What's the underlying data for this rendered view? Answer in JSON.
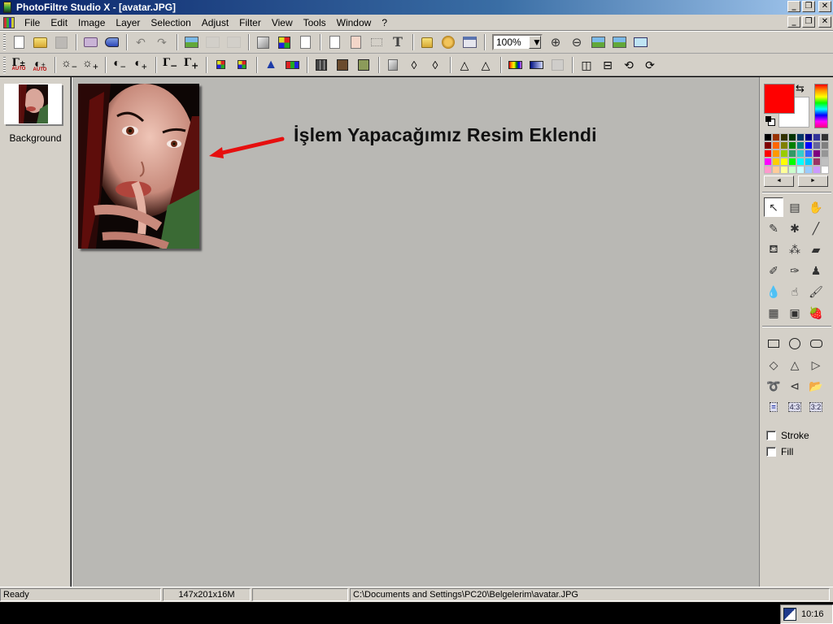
{
  "window": {
    "title": "PhotoFiltre Studio X - [avatar.JPG]",
    "controls": {
      "minimize": "_",
      "restore": "❐",
      "close": "✕"
    }
  },
  "menu": {
    "items": [
      "File",
      "Edit",
      "Image",
      "Layer",
      "Selection",
      "Adjust",
      "Filter",
      "View",
      "Tools",
      "Window",
      "?"
    ]
  },
  "toolbar1": {
    "buttons": [
      {
        "name": "new-icon"
      },
      {
        "name": "open-icon"
      },
      {
        "name": "save-icon",
        "disabled": true
      },
      {
        "name": "print-icon"
      },
      {
        "name": "scan-icon"
      },
      {
        "name": "undo-icon",
        "disabled": true
      },
      {
        "name": "redo-icon",
        "disabled": true
      },
      {
        "name": "image-browser-icon"
      },
      {
        "name": "paste-as-image-icon",
        "disabled": true
      },
      {
        "name": "duplicate-icon",
        "disabled": true
      },
      {
        "name": "grayscale-icon"
      },
      {
        "name": "color-count-icon"
      },
      {
        "name": "transparency-icon"
      },
      {
        "name": "image-size-icon"
      },
      {
        "name": "canvas-size-icon"
      },
      {
        "name": "selection-icon"
      },
      {
        "name": "text-icon"
      },
      {
        "name": "explorer-icon"
      },
      {
        "name": "plugin-icon"
      },
      {
        "name": "window-icon"
      }
    ],
    "zoom": {
      "value": "100%"
    },
    "zoom_buttons": [
      "zoom-in-icon",
      "zoom-out-icon",
      "fit-image-icon",
      "actual-size-icon",
      "slideshow-icon"
    ],
    "glyphs": {
      "undo": "↶",
      "redo": "↷",
      "text": "T",
      "zoom_in": "⊕",
      "zoom_out": "⊖",
      "dropdown": "▼"
    }
  },
  "toolbar2": {
    "auto_label": "AUTO",
    "glyphs": {
      "gamma": "Γ",
      "plusminus": "±",
      "contrast": "◐",
      "sun": "☼",
      "minus": "−",
      "plus": "+",
      "drop": "◊",
      "cone": "△",
      "mirror": "◫",
      "flip": "⊟",
      "rotate": "⟲",
      "rotate2": "⟳"
    }
  },
  "layers": {
    "items": [
      {
        "name": "Background"
      }
    ]
  },
  "canvas": {
    "annotation": "İşlem Yapacağımız Resim Eklendi",
    "annotation_color": "#e60f0f"
  },
  "colors": {
    "foreground": "#ff0000",
    "background": "#ffffff",
    "swap_glyph": "⇆",
    "palette": [
      "#000000",
      "#993300",
      "#333300",
      "#003300",
      "#003366",
      "#000080",
      "#333399",
      "#333333",
      "#800000",
      "#ff6600",
      "#808000",
      "#008000",
      "#008080",
      "#0000ff",
      "#666699",
      "#808080",
      "#ff0000",
      "#ff9900",
      "#99cc00",
      "#339966",
      "#33cccc",
      "#3366ff",
      "#800080",
      "#969696",
      "#ff00ff",
      "#ffcc00",
      "#ffff00",
      "#00ff00",
      "#00ffff",
      "#00ccff",
      "#993366",
      "#c0c0c0",
      "#ff99cc",
      "#ffcc99",
      "#ffff99",
      "#ccffcc",
      "#ccffff",
      "#99ccff",
      "#cc99ff",
      "#ffffff"
    ],
    "nav": {
      "left": "◄",
      "right": "►"
    }
  },
  "tools": {
    "items": [
      {
        "name": "select-arrow-icon",
        "glyph": "↖",
        "active": true
      },
      {
        "name": "select-window-icon",
        "glyph": "▤"
      },
      {
        "name": "hand-icon",
        "glyph": "✋"
      },
      {
        "name": "eyedropper-icon",
        "glyph": "✎"
      },
      {
        "name": "magic-wand-icon",
        "glyph": "✱"
      },
      {
        "name": "line-icon",
        "glyph": "╱"
      },
      {
        "name": "fill-bucket-icon",
        "glyph": "⛾"
      },
      {
        "name": "spray-icon",
        "glyph": "⁂"
      },
      {
        "name": "eraser-icon",
        "glyph": "▰"
      },
      {
        "name": "brush-icon",
        "glyph": "✐"
      },
      {
        "name": "advanced-brush-icon",
        "glyph": "✑"
      },
      {
        "name": "clone-stamp-icon",
        "glyph": "♟"
      },
      {
        "name": "blur-drop-icon",
        "glyph": "💧"
      },
      {
        "name": "finger-smudge-icon",
        "glyph": "☝"
      },
      {
        "name": "pattern-brush-icon",
        "glyph": "🖌"
      },
      {
        "name": "deform-grid-icon",
        "glyph": "▦"
      },
      {
        "name": "portrait-icon",
        "glyph": "▣"
      },
      {
        "name": "strawberry-icon",
        "glyph": "🍓"
      }
    ],
    "shapes": [
      {
        "name": "rectangle-shape-icon"
      },
      {
        "name": "ellipse-shape-icon"
      },
      {
        "name": "rounded-rect-shape-icon"
      },
      {
        "name": "diamond-shape-icon",
        "glyph": "◇"
      },
      {
        "name": "triangle-shape-icon",
        "glyph": "△"
      },
      {
        "name": "right-triangle-shape-icon",
        "glyph": "▷"
      },
      {
        "name": "lasso-icon",
        "glyph": "➰"
      },
      {
        "name": "polygon-lasso-icon",
        "glyph": "⊲"
      },
      {
        "name": "open-shape-icon",
        "glyph": "📂"
      },
      {
        "name": "ratio-free-icon",
        "glyph": "="
      },
      {
        "name": "ratio-4-3-icon",
        "glyph": "4:3"
      },
      {
        "name": "ratio-3-2-icon",
        "glyph": "3:2"
      }
    ],
    "stroke_label": "Stroke",
    "fill_label": "Fill"
  },
  "statusbar": {
    "status": "Ready",
    "dimensions": "147x201x16M",
    "info": "",
    "path": "C:\\Documents and Settings\\PC20\\Belgelerim\\avatar.JPG"
  },
  "taskbar": {
    "time": "10:16"
  }
}
